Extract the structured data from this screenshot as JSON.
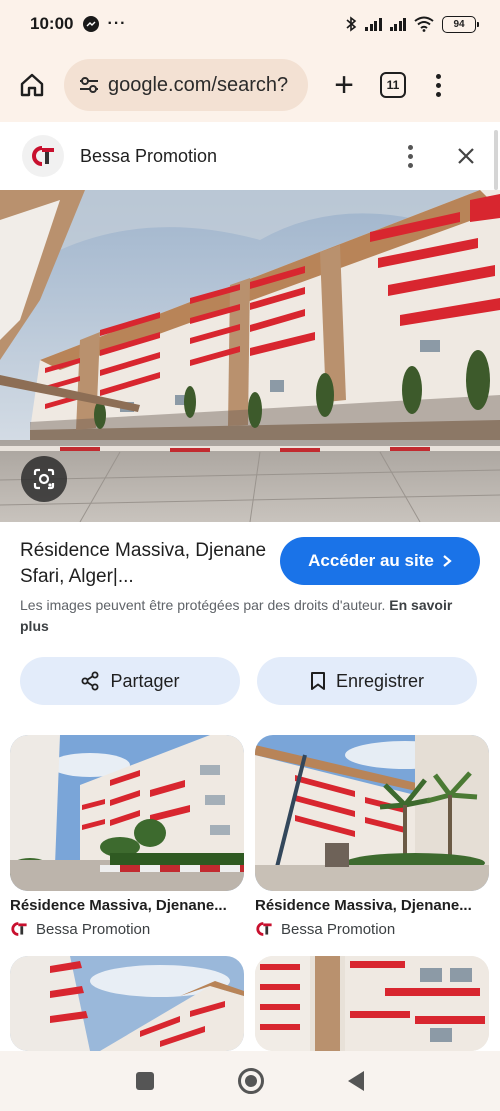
{
  "status": {
    "time": "10:00",
    "battery": "94"
  },
  "browser": {
    "url": "google.com/search?",
    "tab_count": "11"
  },
  "source": {
    "name": "Bessa Promotion"
  },
  "result": {
    "title": "Résidence Massiva, Djenane Sfari, Alger|...",
    "visit_label": "Accéder au site",
    "copyright_text": "Les images peuvent être protégées par des droits d'auteur.",
    "learn_more": "En savoir plus"
  },
  "actions": {
    "share_label": "Partager",
    "save_label": "Enregistrer"
  },
  "related": [
    {
      "title": "Résidence Massiva, Djenane...",
      "source": "Bessa Promotion"
    },
    {
      "title": "Résidence Massiva, Djenane...",
      "source": "Bessa Promotion"
    }
  ],
  "colors": {
    "accent_blue": "#1a73e8",
    "browser_bar": "#fcf2ea",
    "balcony_red": "#d8262f",
    "button_tint": "#e3ecfa"
  }
}
